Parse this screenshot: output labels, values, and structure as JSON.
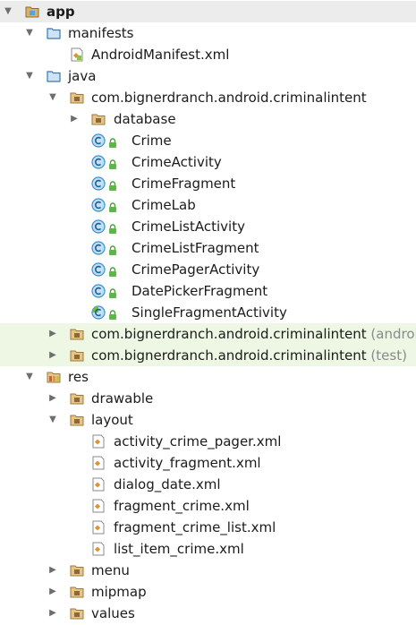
{
  "tree": [
    {
      "level": 0,
      "arrow": "expanded",
      "icon": "module-folder-icon",
      "label": "app",
      "bold": true,
      "top": true
    },
    {
      "level": 1,
      "arrow": "expanded",
      "icon": "folder-blue-icon",
      "label": "manifests"
    },
    {
      "level": 2,
      "arrow": "none",
      "icon": "manifest-file-icon",
      "label": "AndroidManifest.xml"
    },
    {
      "level": 1,
      "arrow": "expanded",
      "icon": "folder-blue-icon",
      "label": "java"
    },
    {
      "level": 2,
      "arrow": "expanded",
      "icon": "package-folder-icon",
      "label": "com.bignerdranch.android.criminalintent"
    },
    {
      "level": 3,
      "arrow": "collapsed",
      "icon": "package-folder-icon",
      "label": "database"
    },
    {
      "level": 3,
      "arrow": "none",
      "icon": "class-icon",
      "lock": true,
      "label": "Crime"
    },
    {
      "level": 3,
      "arrow": "none",
      "icon": "class-icon",
      "lock": true,
      "label": "CrimeActivity"
    },
    {
      "level": 3,
      "arrow": "none",
      "icon": "class-icon",
      "lock": true,
      "label": "CrimeFragment"
    },
    {
      "level": 3,
      "arrow": "none",
      "icon": "class-icon",
      "lock": true,
      "label": "CrimeLab"
    },
    {
      "level": 3,
      "arrow": "none",
      "icon": "class-icon",
      "lock": true,
      "label": "CrimeListActivity"
    },
    {
      "level": 3,
      "arrow": "none",
      "icon": "class-icon",
      "lock": true,
      "label": "CrimeListFragment"
    },
    {
      "level": 3,
      "arrow": "none",
      "icon": "class-icon",
      "lock": true,
      "label": "CrimePagerActivity"
    },
    {
      "level": 3,
      "arrow": "none",
      "icon": "class-icon",
      "lock": true,
      "label": "DatePickerFragment"
    },
    {
      "level": 3,
      "arrow": "none",
      "icon": "abstract-class-icon",
      "lock": true,
      "label": "SingleFragmentActivity"
    },
    {
      "level": 2,
      "arrow": "collapsed",
      "icon": "package-folder-icon",
      "label": "com.bignerdranch.android.criminalintent",
      "suffix": " (androidTest)",
      "highlight": true
    },
    {
      "level": 2,
      "arrow": "collapsed",
      "icon": "package-folder-icon",
      "label": "com.bignerdranch.android.criminalintent",
      "suffix": " (test)",
      "highlight": true
    },
    {
      "level": 1,
      "arrow": "expanded",
      "icon": "res-folder-icon",
      "label": "res"
    },
    {
      "level": 2,
      "arrow": "collapsed",
      "icon": "package-folder-icon",
      "label": "drawable"
    },
    {
      "level": 2,
      "arrow": "expanded",
      "icon": "package-folder-icon",
      "label": "layout"
    },
    {
      "level": 3,
      "arrow": "none",
      "icon": "layout-file-icon",
      "label": "activity_crime_pager.xml"
    },
    {
      "level": 3,
      "arrow": "none",
      "icon": "layout-file-icon",
      "label": "activity_fragment.xml"
    },
    {
      "level": 3,
      "arrow": "none",
      "icon": "layout-file-icon",
      "label": "dialog_date.xml"
    },
    {
      "level": 3,
      "arrow": "none",
      "icon": "layout-file-icon",
      "label": "fragment_crime.xml"
    },
    {
      "level": 3,
      "arrow": "none",
      "icon": "layout-file-icon",
      "label": "fragment_crime_list.xml"
    },
    {
      "level": 3,
      "arrow": "none",
      "icon": "layout-file-icon",
      "label": "list_item_crime.xml"
    },
    {
      "level": 2,
      "arrow": "collapsed",
      "icon": "package-folder-icon",
      "label": "menu"
    },
    {
      "level": 2,
      "arrow": "collapsed",
      "icon": "package-folder-icon",
      "label": "mipmap"
    },
    {
      "level": 2,
      "arrow": "collapsed",
      "icon": "package-folder-icon",
      "label": "values"
    }
  ]
}
